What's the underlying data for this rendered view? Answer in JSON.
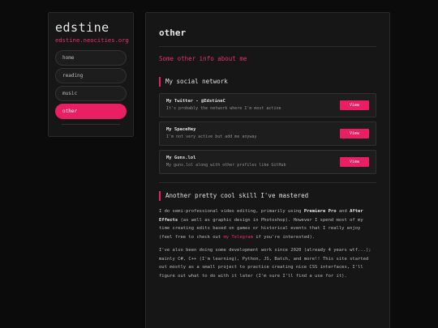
{
  "sidebar": {
    "title": "edstine",
    "url": "edstine.neocities.org",
    "nav": [
      {
        "label": "home"
      },
      {
        "label": "reading"
      },
      {
        "label": "music"
      },
      {
        "label": "other"
      }
    ]
  },
  "main": {
    "title": "other",
    "subtitle": "Some other info about me",
    "social": {
      "heading": "My social network",
      "cards": [
        {
          "title": "My Twitter - @EdstineC",
          "desc": "It's probably the network where I'm most active",
          "button": "View"
        },
        {
          "title": "My SpaceHey",
          "desc": "I'm not very active but add me anyway",
          "button": "View"
        },
        {
          "title": "My Guns.lol",
          "desc": "My guns.lol along with other profiles like GitHub",
          "button": "View"
        }
      ]
    },
    "skill": {
      "heading": "Another pretty cool skill I've mastered",
      "p1": {
        "a": "I do semi-professional video editing, primarily using ",
        "b1": "Premiere Pro",
        "c": " and ",
        "b2": "After Effects",
        "d": " (as well as graphic design in Photoshop). However I spend most of my time creating edits based on games or historical events that I really enjoy (feel free to check out ",
        "link": "my Telegram",
        "e": " if you're interested)."
      },
      "p2": "I've also been doing some development work since 2020 (already 4 years wtf...); mainly C#, C++ (I'm learning), Python, JS, Batch, and more!! This site started out mostly as a small project to practice creating nice CSS interfaces, I'll figure out what to do with it later (I'm sure I'll find a use for it)."
    }
  },
  "colors": {
    "accent": "#e91e63",
    "background": "#0b0b0b",
    "panel": "#161616"
  }
}
